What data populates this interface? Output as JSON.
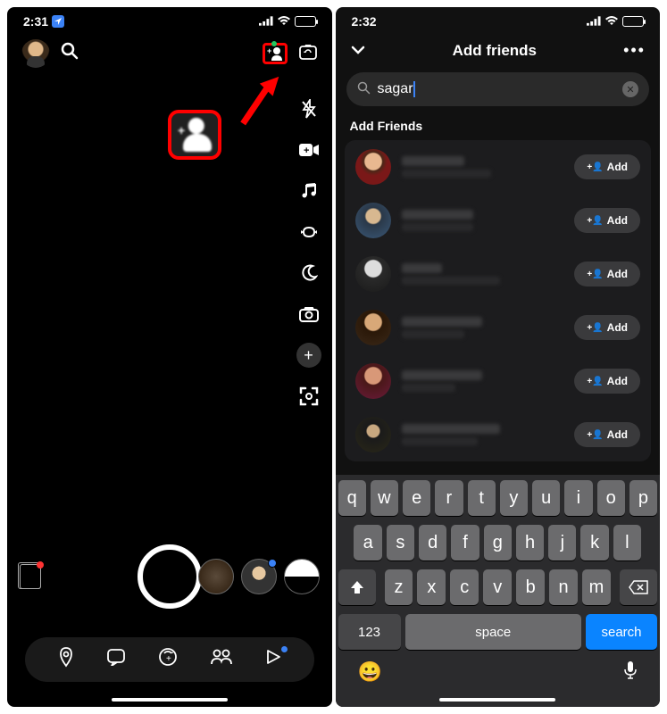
{
  "statusBar": {
    "timeLeft": "2:31",
    "timeRight": "2:32"
  },
  "leftPhone": {
    "sideTools": [
      "flash",
      "video",
      "music",
      "loop",
      "moon",
      "camera",
      "plus",
      "scan"
    ]
  },
  "rightPhone": {
    "header": {
      "title": "Add friends"
    },
    "search": {
      "query": "sagar"
    },
    "sectionTitle": "Add Friends",
    "addLabel": "Add",
    "friends": [
      1,
      2,
      3,
      4,
      5,
      6
    ]
  },
  "keyboard": {
    "row1": [
      "q",
      "w",
      "e",
      "r",
      "t",
      "y",
      "u",
      "i",
      "o",
      "p"
    ],
    "row2": [
      "a",
      "s",
      "d",
      "f",
      "g",
      "h",
      "j",
      "k",
      "l"
    ],
    "row3": [
      "z",
      "x",
      "c",
      "v",
      "b",
      "n",
      "m"
    ],
    "numLabel": "123",
    "spaceLabel": "space",
    "searchLabel": "search"
  }
}
